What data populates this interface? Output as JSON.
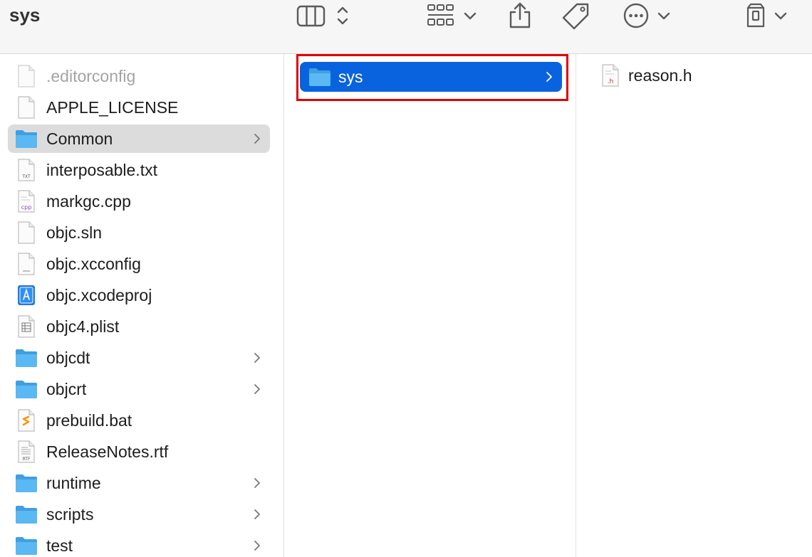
{
  "window": {
    "title": "sys"
  },
  "toolbar": {
    "icons": [
      "columns-view-icon",
      "updown-chevron-icon",
      "group-grid-icon",
      "chevron-down-icon",
      "share-icon",
      "tag-icon",
      "more-icon",
      "chevron-down-icon",
      "storage-icon",
      "chevron-down-icon"
    ]
  },
  "column1": {
    "items": [
      {
        "label": ".editorconfig",
        "kind": "file",
        "dimmed": true
      },
      {
        "label": "APPLE_LICENSE",
        "kind": "file"
      },
      {
        "label": "Common",
        "kind": "folder",
        "selected": true
      },
      {
        "label": "interposable.txt",
        "kind": "txt",
        "badge": "TXT"
      },
      {
        "label": "markgc.cpp",
        "kind": "cpp",
        "badge": "cpp"
      },
      {
        "label": "objc.sln",
        "kind": "file"
      },
      {
        "label": "objc.xcconfig",
        "kind": "config"
      },
      {
        "label": "objc.xcodeproj",
        "kind": "xcodeproj"
      },
      {
        "label": "objc4.plist",
        "kind": "plist"
      },
      {
        "label": "objcdt",
        "kind": "folder"
      },
      {
        "label": "objcrt",
        "kind": "folder"
      },
      {
        "label": "prebuild.bat",
        "kind": "bat"
      },
      {
        "label": "ReleaseNotes.rtf",
        "kind": "rtf",
        "badge": "RTF"
      },
      {
        "label": "runtime",
        "kind": "folder"
      },
      {
        "label": "scripts",
        "kind": "folder"
      },
      {
        "label": "test",
        "kind": "folder"
      }
    ]
  },
  "column2": {
    "items": [
      {
        "label": "sys",
        "kind": "folder",
        "selected": true
      }
    ]
  },
  "column3": {
    "items": [
      {
        "label": "reason.h",
        "kind": "h",
        "badge": ".h"
      }
    ]
  },
  "colors": {
    "accent": "#0a63de",
    "folder": "#52b6f2",
    "highlight": "#e00000"
  }
}
